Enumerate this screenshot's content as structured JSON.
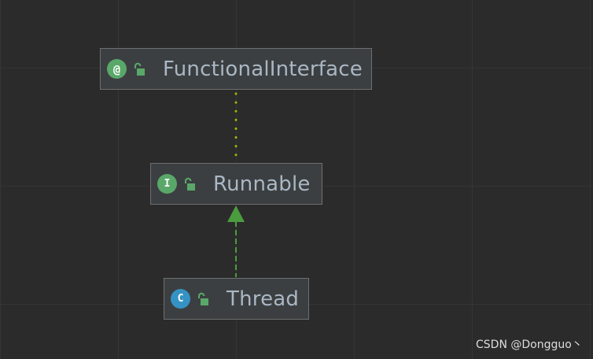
{
  "diagram": {
    "nodes": [
      {
        "id": "functional-interface",
        "kind": "annotation",
        "kind_letter": "@",
        "name": "FunctionalInterface",
        "visibility": "public",
        "icon": "annotation-icon",
        "color": "#59a869"
      },
      {
        "id": "runnable",
        "kind": "interface",
        "kind_letter": "I",
        "name": "Runnable",
        "visibility": "public",
        "icon": "interface-icon",
        "color": "#59a869"
      },
      {
        "id": "thread",
        "kind": "class",
        "kind_letter": "C",
        "name": "Thread",
        "visibility": "public",
        "icon": "class-icon",
        "color": "#3592c4"
      }
    ],
    "edges": [
      {
        "from": "runnable",
        "to": "functional-interface",
        "relation": "annotated-with",
        "style": "dotted",
        "color": "#a8b300"
      },
      {
        "from": "thread",
        "to": "runnable",
        "relation": "implements",
        "style": "dashed-arrow",
        "color": "#4a9c3f"
      }
    ]
  },
  "watermark": "CSDN @Dongguo丶",
  "colors": {
    "background": "#2b2b2b",
    "node_fill": "#3c3f41",
    "node_border": "#6e6e6e",
    "node_text": "#aab7c4"
  }
}
